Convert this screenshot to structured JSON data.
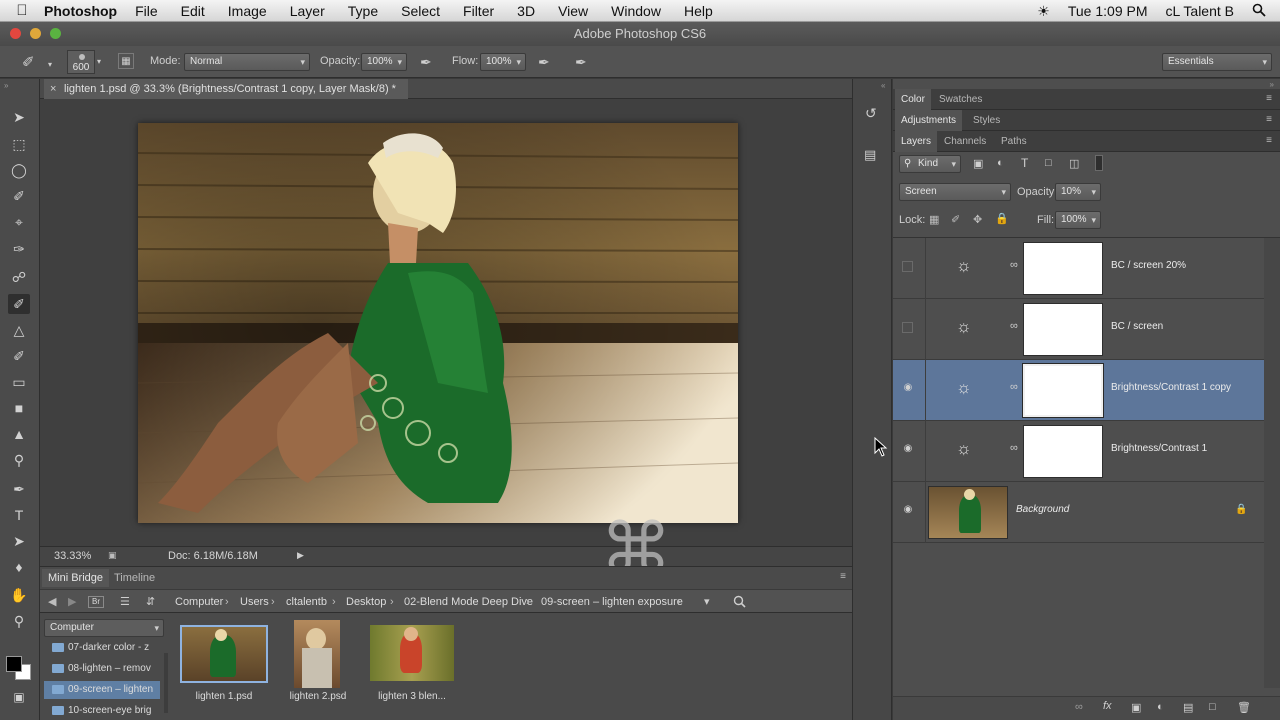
{
  "menubar": {
    "app": "Photoshop",
    "items": [
      "File",
      "Edit",
      "Image",
      "Layer",
      "Type",
      "Select",
      "Filter",
      "3D",
      "View",
      "Window",
      "Help"
    ],
    "clock": "Tue 1:09 PM",
    "user": "cL Talent B"
  },
  "window": {
    "title": "Adobe Photoshop CS6"
  },
  "options_bar": {
    "brush_size": "600",
    "mode_label": "Mode:",
    "mode_value": "Normal",
    "opacity_label": "Opacity:",
    "opacity_value": "100%",
    "flow_label": "Flow:",
    "flow_value": "100%",
    "workspace": "Essentials"
  },
  "document": {
    "tab_title": "lighten 1.psd @ 33.3% (Brightness/Contrast 1 copy, Layer Mask/8) *",
    "zoom": "33.33%",
    "doc_size": "Doc: 6.18M/6.18M",
    "overlay_glyph": "⌘"
  },
  "mini_bridge": {
    "tabs": [
      "Mini Bridge",
      "Timeline"
    ],
    "breadcrumb": [
      "Computer",
      "Users",
      "cltalentb",
      "Desktop",
      "02-Blend Mode Deep Dive",
      "09-screen – lighten exposure"
    ],
    "location": "Computer",
    "folders": [
      "07-darker color - z",
      "08-lighten – remov",
      "09-screen – lighten",
      "10-screen-eye brig"
    ],
    "selected_folder_index": 2,
    "thumbnails": [
      "lighten 1.psd",
      "lighten 2.psd",
      "lighten 3 blen..."
    ]
  },
  "panels": {
    "group1": [
      "Color",
      "Swatches"
    ],
    "group2": [
      "Adjustments",
      "Styles"
    ],
    "group3": [
      "Layers",
      "Channels",
      "Paths"
    ],
    "filter_kind": "Kind",
    "blend_mode": "Screen",
    "opacity_label": "Opacity:",
    "opacity_value": "10%",
    "lock_label": "Lock:",
    "fill_label": "Fill:",
    "fill_value": "100%"
  },
  "layers": [
    {
      "name": "BC / screen 20%",
      "visible": false,
      "selected": false
    },
    {
      "name": "BC / screen",
      "visible": false,
      "selected": false
    },
    {
      "name": "Brightness/Contrast 1 copy",
      "visible": true,
      "selected": true
    },
    {
      "name": "Brightness/Contrast 1",
      "visible": true,
      "selected": false
    },
    {
      "name": "Background",
      "visible": true,
      "selected": false
    }
  ],
  "colors": {
    "selection": "#5d769a",
    "foreground": "#000000",
    "background": "#ffffff"
  }
}
